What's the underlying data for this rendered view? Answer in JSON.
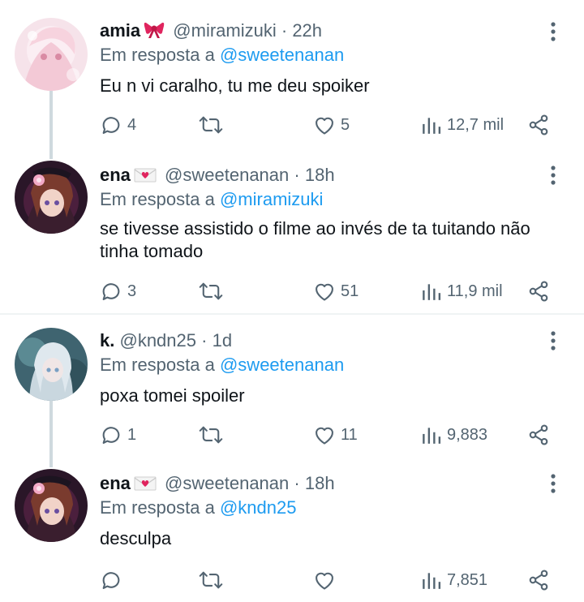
{
  "tweets": [
    {
      "name": "amia",
      "handle": "@miramizuki",
      "sep": "·",
      "time": "22h",
      "reply_prefix": "Em resposta a",
      "reply_to": "@sweetenanan",
      "text": "Eu n vi caralho, tu me deu spoiker",
      "replies": "4",
      "retweets": "",
      "likes": "5",
      "views": "12,7 mil",
      "name_emoji": "ribbon-icon"
    },
    {
      "name": "ena",
      "handle": "@sweetenanan",
      "sep": "·",
      "time": "18h",
      "reply_prefix": "Em resposta a",
      "reply_to": "@miramizuki",
      "text": "se tivesse assistido o filme ao invés de ta tuitando não tinha tomado",
      "replies": "3",
      "retweets": "",
      "likes": "51",
      "views": "11,9 mil",
      "name_emoji": "love-letter-icon"
    },
    {
      "name": "k.",
      "handle": "@kndn25",
      "sep": "·",
      "time": "1d",
      "reply_prefix": "Em resposta a",
      "reply_to": "@sweetenanan",
      "text": "poxa tomei spoiler",
      "replies": "1",
      "retweets": "",
      "likes": "11",
      "views": "9,883"
    },
    {
      "name": "ena",
      "handle": "@sweetenanan",
      "sep": "·",
      "time": "18h",
      "reply_prefix": "Em resposta a",
      "reply_to": "@kndn25",
      "text": "desculpa",
      "replies": "",
      "retweets": "",
      "likes": "",
      "views": "7,851",
      "name_emoji": "love-letter-icon"
    }
  ],
  "colors": {
    "link": "#1d9bf0",
    "secondary": "#536471",
    "thread_line": "#cfd9de",
    "divider": "#eff3f4"
  }
}
